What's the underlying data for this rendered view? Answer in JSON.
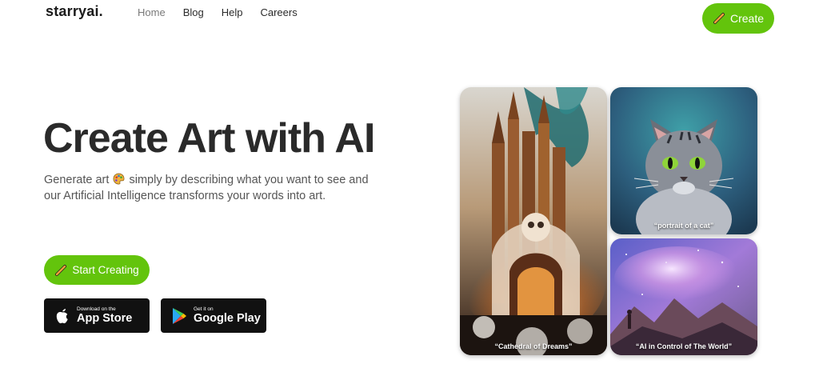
{
  "brand": {
    "name": "starryai",
    "dot": "."
  },
  "nav": [
    {
      "label": "Home",
      "active": true
    },
    {
      "label": "Blog"
    },
    {
      "label": "Help"
    },
    {
      "label": "Careers"
    }
  ],
  "header": {
    "create_label": "Create"
  },
  "hero": {
    "title": "Create Art with AI",
    "subtitle_part1": "Generate art",
    "subtitle_part2": "simply by describing what you want to see and our Artificial Intelligence transforms your words into art.",
    "start_label": "Start Creating"
  },
  "stores": {
    "apple": {
      "small": "Download on the",
      "big": "App Store"
    },
    "google": {
      "small": "Get it on",
      "big": "Google Play"
    }
  },
  "gallery": {
    "cathedral_caption": "“Cathedral of Dreams”",
    "cat_caption": "“portrait of a cat”",
    "space_caption": "“AI in Control of The World”"
  },
  "colors": {
    "accent": "#63c40c",
    "title": "#2a2a2a",
    "store_bg": "#111111"
  }
}
